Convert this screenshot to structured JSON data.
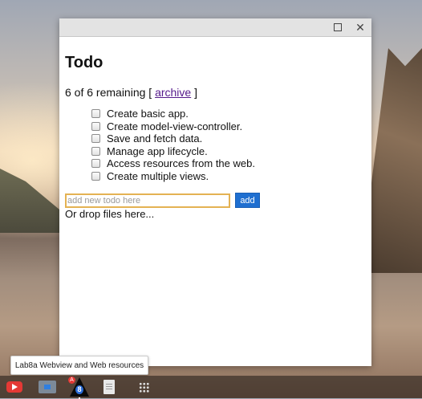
{
  "window": {
    "maximize_icon": "maximize-icon",
    "close_icon": "close-icon"
  },
  "app": {
    "title": "Todo",
    "remaining_text": "6 of 6 remaining [",
    "archive_link": "archive",
    "remaining_suffix": "]",
    "todos": [
      {
        "label": "Create basic app.",
        "done": false
      },
      {
        "label": "Create model-view-controller.",
        "done": false
      },
      {
        "label": "Save and fetch data.",
        "done": false
      },
      {
        "label": "Manage app lifecycle.",
        "done": false
      },
      {
        "label": "Access resources from the web.",
        "done": false
      },
      {
        "label": "Create multiple views.",
        "done": false
      }
    ],
    "new_todo_placeholder": "add new todo here",
    "add_button": "add",
    "drop_text": "Or drop files here..."
  },
  "shelf": {
    "tooltip": "Lab8a Webview and Web resources",
    "items": [
      {
        "name": "youtube-icon"
      },
      {
        "name": "files-icon"
      },
      {
        "name": "lab8a-app-icon",
        "badge_letter": "A",
        "badge_number": "8"
      },
      {
        "name": "docs-icon"
      },
      {
        "name": "app-launcher-icon"
      }
    ]
  }
}
